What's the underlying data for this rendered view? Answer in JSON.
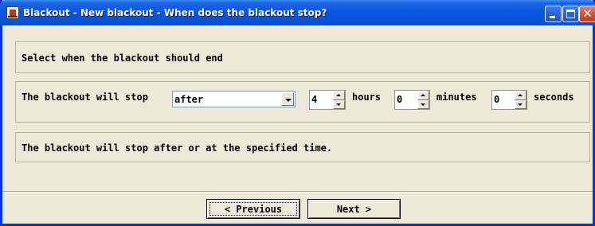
{
  "window": {
    "title": "Blackout - New blackout - When does the blackout stop?"
  },
  "instructions": {
    "text": "Select when the blackout should end"
  },
  "stop_row": {
    "prefix": "The blackout will stop",
    "mode": {
      "selected": "after"
    },
    "hours": {
      "value": "4",
      "unit": "hours"
    },
    "minutes": {
      "value": "0",
      "unit": "minutes"
    },
    "seconds": {
      "value": "0",
      "unit": "seconds"
    }
  },
  "summary": {
    "text": "The blackout will stop after or at the specified time."
  },
  "buttons": {
    "previous": "< Previous",
    "next": "Next >"
  },
  "colors": {
    "titlebar": "#0a58e2",
    "window_bg": "#ece9d8",
    "close_button": "#d5553a"
  }
}
